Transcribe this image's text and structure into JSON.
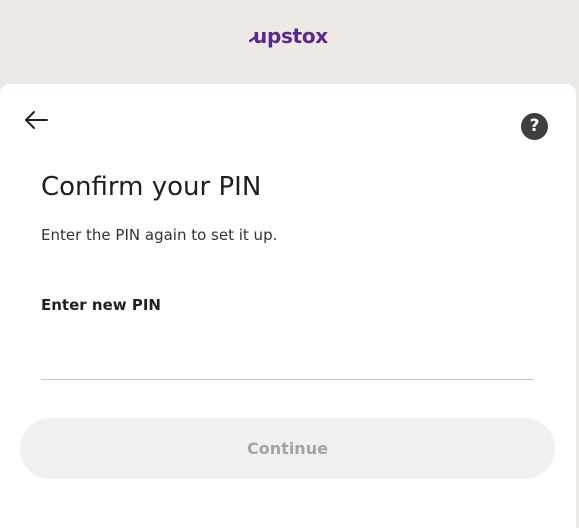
{
  "header": {
    "brand": "upstox"
  },
  "card": {
    "back_icon": "arrow-left-icon",
    "help_icon": "question-mark-icon",
    "help_symbol": "?",
    "title": "Confirm your PIN",
    "subtitle": "Enter the PIN again to set it up.",
    "pin_field": {
      "label": "Enter new PIN",
      "value": "",
      "placeholder": ""
    },
    "continue_button": {
      "label": "Continue",
      "state": "disabled"
    }
  },
  "colors": {
    "brand": "#5a298b",
    "background": "#ede9e4",
    "card": "#ffffff",
    "button_disabled_bg": "#f0f0f0",
    "button_disabled_text": "#a3a3a3"
  }
}
